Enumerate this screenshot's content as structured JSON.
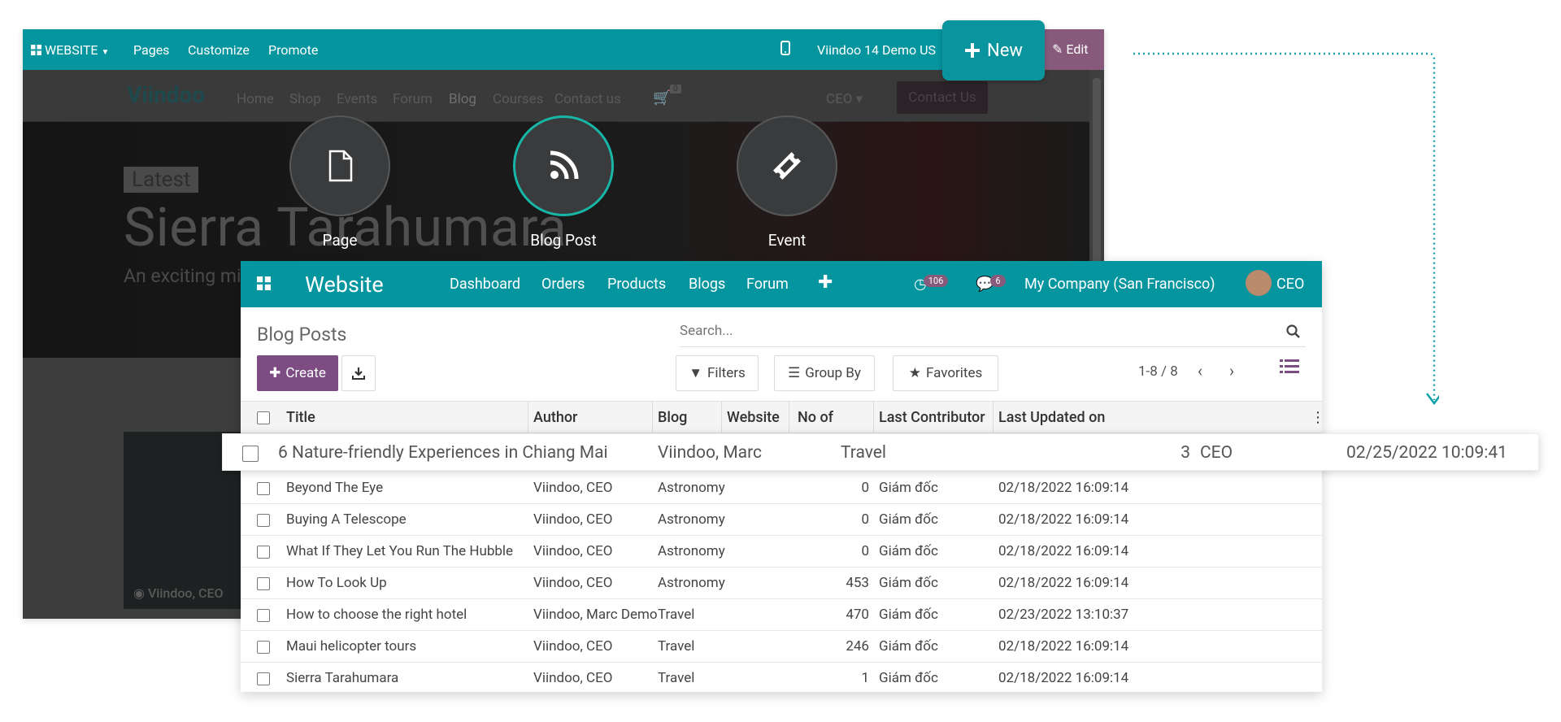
{
  "site_editor": {
    "website_menu": "WEBSITE",
    "menu": [
      "Pages",
      "Customize",
      "Promote"
    ],
    "site_name": "Viindoo 14 Demo US",
    "edit_label": "Edit",
    "logo": "Viindoo",
    "nav": [
      "Home",
      "Shop",
      "Events",
      "Forum",
      "Blog",
      "Courses",
      "Contact us"
    ],
    "cart_count": "0",
    "user": "CEO",
    "contact_button": "Contact Us",
    "hero_badge": "Latest",
    "hero_title": "Sierra Tarahumara",
    "hero_subtitle": "An exciting mi",
    "card_author": "Viindoo, CEO"
  },
  "new_button": {
    "label": "New",
    "icon": "plus-icon"
  },
  "choices": [
    {
      "label": "Page",
      "icon": "file-icon"
    },
    {
      "label": "Blog Post",
      "icon": "rss-icon"
    },
    {
      "label": "Event",
      "icon": "ticket-icon"
    }
  ],
  "backend": {
    "app_name": "Website",
    "nav": [
      "Dashboard",
      "Orders",
      "Products",
      "Blogs",
      "Forum"
    ],
    "activity_count": "106",
    "message_count": "6",
    "company": "My Company (San Francisco)",
    "user": "CEO",
    "page_title": "Blog Posts",
    "search_placeholder": "Search...",
    "create_label": "Create",
    "filters_label": "Filters",
    "groupby_label": "Group By",
    "favorites_label": "Favorites",
    "pager": "1-8 / 8",
    "columns": [
      "Title",
      "Author",
      "Blog",
      "Website",
      "No of Views",
      "Last Contributor",
      "Last Updated on"
    ],
    "dragged_row": {
      "title": "6 Nature-friendly Experiences in Chiang Mai",
      "author": "Viindoo, Marc",
      "blog": "Travel",
      "views": "3",
      "contributor": "CEO",
      "updated": "02/25/2022 10:09:41"
    },
    "rows": [
      {
        "title": "Beyond The Eye",
        "author": "Viindoo, CEO",
        "blog": "Astronomy",
        "views": "0",
        "contributor": "Giám đốc",
        "updated": "02/18/2022 16:09:14"
      },
      {
        "title": "Buying A Telescope",
        "author": "Viindoo, CEO",
        "blog": "Astronomy",
        "views": "0",
        "contributor": "Giám đốc",
        "updated": "02/18/2022 16:09:14"
      },
      {
        "title": "What If They Let You Run The Hubble",
        "author": "Viindoo, CEO",
        "blog": "Astronomy",
        "views": "0",
        "contributor": "Giám đốc",
        "updated": "02/18/2022 16:09:14"
      },
      {
        "title": "How To Look Up",
        "author": "Viindoo, CEO",
        "blog": "Astronomy",
        "views": "453",
        "contributor": "Giám đốc",
        "updated": "02/18/2022 16:09:14"
      },
      {
        "title": "How to choose the right hotel",
        "author": "Viindoo, Marc Demo",
        "blog": "Travel",
        "views": "470",
        "contributor": "Giám đốc",
        "updated": "02/23/2022 13:10:37"
      },
      {
        "title": "Maui helicopter tours",
        "author": "Viindoo, CEO",
        "blog": "Travel",
        "views": "246",
        "contributor": "Giám đốc",
        "updated": "02/18/2022 16:09:14"
      },
      {
        "title": "Sierra Tarahumara",
        "author": "Viindoo, CEO",
        "blog": "Travel",
        "views": "1",
        "contributor": "Giám đốc",
        "updated": "02/18/2022 16:09:14"
      }
    ]
  },
  "colors": {
    "teal": "#04959f",
    "purple": "#875a7b",
    "selected_ring": "#17b6a7"
  }
}
